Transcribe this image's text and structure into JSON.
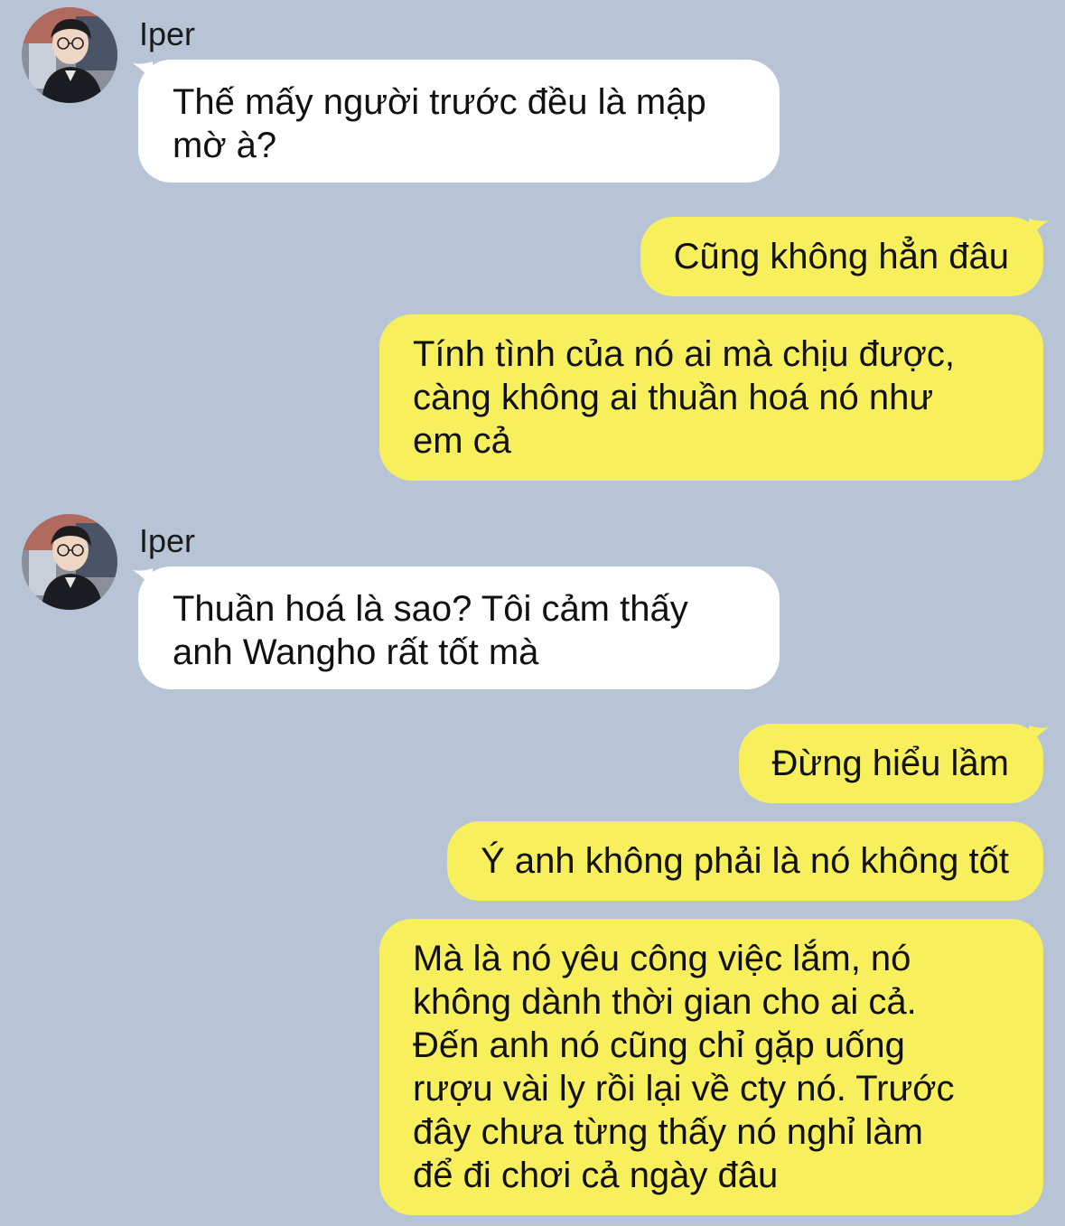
{
  "colors": {
    "background": "#b7c4d5",
    "incoming_bubble": "#ffffff",
    "outgoing_bubble": "#f8ef5d"
  },
  "messages": [
    {
      "direction": "incoming",
      "sender": "Iper",
      "avatar": "profile-photo",
      "text": "Thế mấy người trước đều là mập\nmờ à?"
    },
    {
      "direction": "outgoing",
      "text": "Cũng không hẳn đâu"
    },
    {
      "direction": "outgoing",
      "text": "Tính tình của nó ai mà chịu được,\ncàng không ai thuần hoá nó như\nem cả"
    },
    {
      "direction": "incoming",
      "sender": "Iper",
      "avatar": "profile-photo",
      "text": "Thuần hoá là sao? Tôi cảm thấy\nanh Wangho rất tốt mà"
    },
    {
      "direction": "outgoing",
      "text": "Đừng hiểu lầm"
    },
    {
      "direction": "outgoing",
      "text": "Ý anh không phải là nó không tốt"
    },
    {
      "direction": "outgoing",
      "text": "Mà là nó yêu công việc lắm, nó\nkhông dành thời gian cho ai cả.\nĐến anh nó cũng chỉ gặp uống\nrượu vài ly rồi lại về cty nó. Trước\nđây chưa từng thấy nó nghỉ làm\nđể đi chơi cả ngày đâu"
    }
  ]
}
